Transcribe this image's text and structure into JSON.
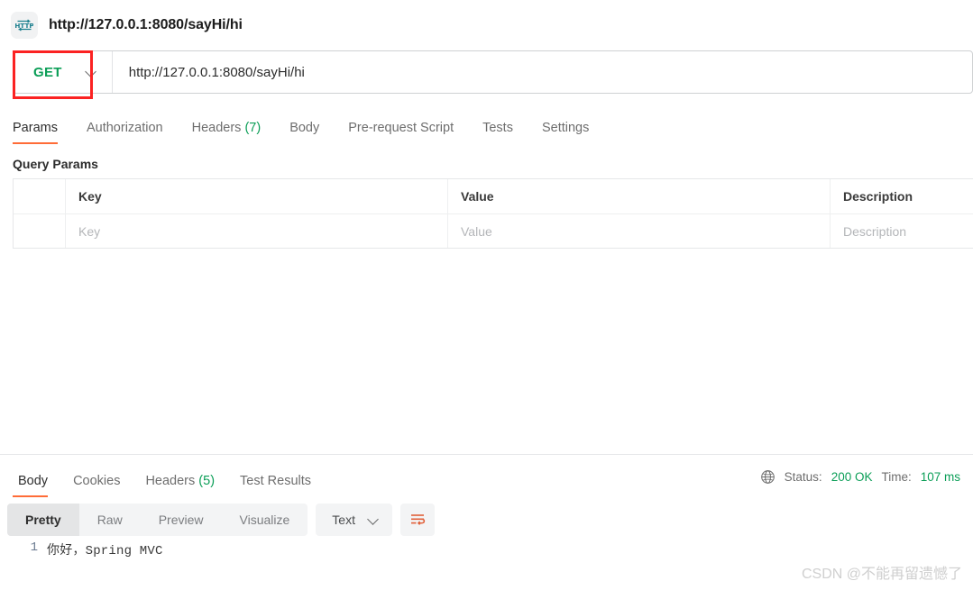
{
  "titlebar": {
    "icon": "http-icon",
    "url": "http://127.0.0.1:8080/sayHi/hi"
  },
  "request": {
    "method": "GET",
    "method_chevron_icon": "chevron-down-icon",
    "url_value": "http://127.0.0.1:8080/sayHi/hi",
    "annotation_color": "#fb2222",
    "method_color": "#0b9e57",
    "tabs": [
      {
        "label": "Params",
        "count": "",
        "active": true
      },
      {
        "label": "Authorization",
        "count": "",
        "active": false
      },
      {
        "label": "Headers",
        "count": "(7)",
        "active": false
      },
      {
        "label": "Body",
        "count": "",
        "active": false
      },
      {
        "label": "Pre-request Script",
        "count": "",
        "active": false
      },
      {
        "label": "Tests",
        "count": "",
        "active": false
      },
      {
        "label": "Settings",
        "count": "",
        "active": false
      }
    ]
  },
  "query_params": {
    "section_title": "Query Params",
    "columns": [
      "Key",
      "Value",
      "Description"
    ],
    "rows": [
      {
        "key": "Key",
        "value": "Value",
        "description": "Description"
      }
    ]
  },
  "response": {
    "tabs": [
      {
        "label": "Body",
        "count": "",
        "active": true
      },
      {
        "label": "Cookies",
        "count": "",
        "active": false
      },
      {
        "label": "Headers",
        "count": "(5)",
        "active": false
      },
      {
        "label": "Test Results",
        "count": "",
        "active": false
      }
    ],
    "globe_icon": "globe-icon",
    "status_label": "Status:",
    "status_value": "200 OK",
    "time_label": "Time:",
    "time_value": "107 ms",
    "status_color": "#0b9e57",
    "toolbar": {
      "views": [
        {
          "label": "Pretty",
          "active": true
        },
        {
          "label": "Raw",
          "active": false
        },
        {
          "label": "Preview",
          "active": false
        },
        {
          "label": "Visualize",
          "active": false
        }
      ],
      "format": "Text",
      "format_chevron_icon": "chevron-down-icon",
      "wrap_icon": "word-wrap-icon",
      "wrap_icon_color": "#e1603a"
    },
    "body_lines": [
      {
        "number": "1",
        "text": "你好，Spring MVC"
      }
    ]
  },
  "watermark": "CSDN @不能再留遗憾了"
}
